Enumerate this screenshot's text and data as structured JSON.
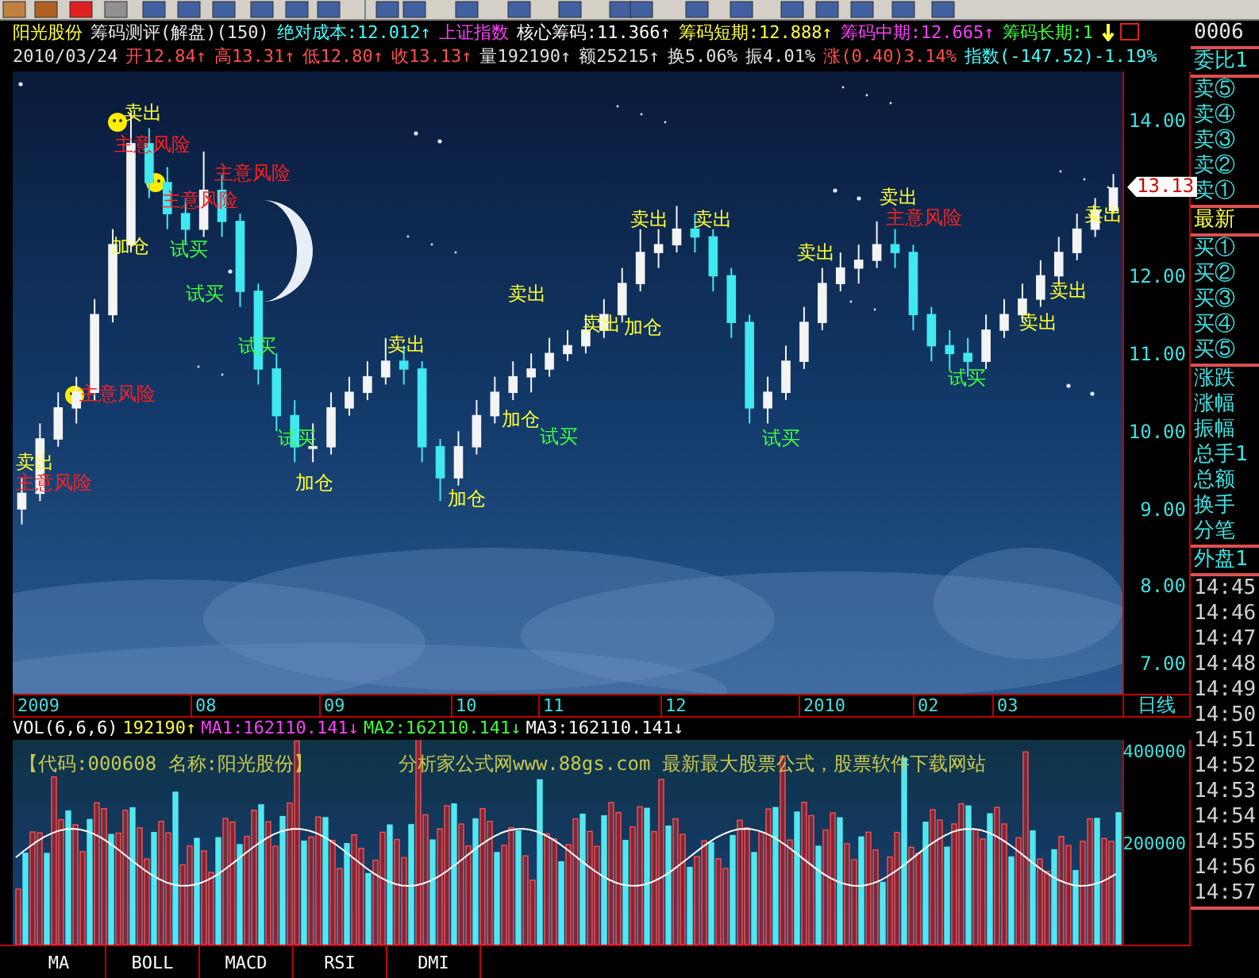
{
  "header": {
    "line1": [
      {
        "text": "阳光股份",
        "color": "#ffff40"
      },
      {
        "text": "筹码测评(解盘)(150)",
        "color": "#e8e8e8"
      },
      {
        "text": "绝对成本:12.012↑",
        "color": "#40ffff"
      },
      {
        "text": "上证指数",
        "color": "#ff40ff"
      },
      {
        "text": "核心筹码:11.366↑",
        "color": "#ffffff"
      },
      {
        "text": "筹码短期:12.888↑",
        "color": "#ffff40"
      },
      {
        "text": "筹码中期:12.665↑",
        "color": "#ff40ff"
      },
      {
        "text": "筹码长期:1",
        "color": "#40ff40"
      }
    ],
    "line2": [
      {
        "text": "2010/03/24",
        "color": "#e0e0e0"
      },
      {
        "text": "开12.84↑",
        "color": "#ff5050"
      },
      {
        "text": "高13.31↑",
        "color": "#ff5050"
      },
      {
        "text": "低12.80↑",
        "color": "#ff5050"
      },
      {
        "text": "收13.13↑",
        "color": "#ff5050"
      },
      {
        "text": "量192190↑",
        "color": "#e0e0e0"
      },
      {
        "text": "额25215↑",
        "color": "#e0e0e0"
      },
      {
        "text": "换5.06%",
        "color": "#e0e0e0"
      },
      {
        "text": "振4.01%",
        "color": "#e0e0e0"
      },
      {
        "text": "涨(0.40)3.14%",
        "color": "#ff5050"
      },
      {
        "text": "指数(-147.52)-1.19%",
        "color": "#40ffff"
      }
    ]
  },
  "chart": {
    "chart_data": {
      "type": "candlestick",
      "ylim": [
        6.62,
        14.63
      ],
      "categories": [
        null,
        null,
        null,
        null,
        null,
        null,
        null,
        null,
        null,
        null,
        null,
        null,
        null,
        null,
        null,
        null,
        null,
        null,
        null,
        null,
        null,
        null,
        null,
        null,
        null,
        null,
        null,
        null,
        null,
        null,
        null,
        null,
        null,
        null,
        null,
        null,
        null,
        null,
        null,
        null,
        null,
        null,
        null,
        null,
        null,
        null,
        null,
        null,
        null,
        null,
        null,
        null,
        null,
        null,
        null,
        null,
        null,
        null,
        null,
        null,
        null
      ],
      "yticks": [
        {
          "value": 14,
          "label": "14.00"
        },
        {
          "value": 12,
          "label": "12.00"
        },
        {
          "value": 11,
          "label": "11.00"
        },
        {
          "value": 10,
          "label": "10.00"
        },
        {
          "value": 9,
          "label": "9.00"
        },
        {
          "value": 8,
          "label": "8.00"
        },
        {
          "value": 7,
          "label": "7.00"
        }
      ],
      "ohlc": [
        [
          9.0,
          9.4,
          8.8,
          9.2
        ],
        [
          9.2,
          10.1,
          9.1,
          9.9
        ],
        [
          9.9,
          10.5,
          9.8,
          10.3
        ],
        [
          10.3,
          10.7,
          10.1,
          10.5
        ],
        [
          10.5,
          11.7,
          10.4,
          11.5
        ],
        [
          11.5,
          12.6,
          11.4,
          12.4
        ],
        [
          12.4,
          14.1,
          12.3,
          13.7
        ],
        [
          13.7,
          13.9,
          13.0,
          13.2
        ],
        [
          13.2,
          13.4,
          12.6,
          12.8
        ],
        [
          12.8,
          13.0,
          12.4,
          12.6
        ],
        [
          12.6,
          13.6,
          12.5,
          13.1
        ],
        [
          13.1,
          13.3,
          12.5,
          12.7
        ],
        [
          12.7,
          12.8,
          11.6,
          11.8
        ],
        [
          11.8,
          11.9,
          10.6,
          10.8
        ],
        [
          10.8,
          11.0,
          10.0,
          10.2
        ],
        [
          10.2,
          10.4,
          9.6,
          9.8
        ],
        [
          9.8,
          10.1,
          9.6,
          9.8
        ],
        [
          9.8,
          10.5,
          9.7,
          10.3
        ],
        [
          10.3,
          10.7,
          10.2,
          10.5
        ],
        [
          10.5,
          10.9,
          10.4,
          10.7
        ],
        [
          10.7,
          11.2,
          10.6,
          10.9
        ],
        [
          10.9,
          11.1,
          10.6,
          10.8
        ],
        [
          10.8,
          10.9,
          9.6,
          9.8
        ],
        [
          9.8,
          9.9,
          9.1,
          9.4
        ],
        [
          9.4,
          10.0,
          9.3,
          9.8
        ],
        [
          9.8,
          10.4,
          9.7,
          10.2
        ],
        [
          10.2,
          10.7,
          10.1,
          10.5
        ],
        [
          10.5,
          10.9,
          10.4,
          10.7
        ],
        [
          10.7,
          11.0,
          10.5,
          10.8
        ],
        [
          10.8,
          11.2,
          10.7,
          11.0
        ],
        [
          11.0,
          11.3,
          10.9,
          11.1
        ],
        [
          11.1,
          11.5,
          11.0,
          11.3
        ],
        [
          11.3,
          11.7,
          11.2,
          11.5
        ],
        [
          11.5,
          12.1,
          11.4,
          11.9
        ],
        [
          11.9,
          12.6,
          11.8,
          12.3
        ],
        [
          12.3,
          12.6,
          12.1,
          12.4
        ],
        [
          12.4,
          12.9,
          12.3,
          12.6
        ],
        [
          12.6,
          12.8,
          12.3,
          12.5
        ],
        [
          12.5,
          12.6,
          11.8,
          12.0
        ],
        [
          12.0,
          12.1,
          11.2,
          11.4
        ],
        [
          11.4,
          11.5,
          10.1,
          10.3
        ],
        [
          10.3,
          10.7,
          10.1,
          10.5
        ],
        [
          10.5,
          11.1,
          10.4,
          10.9
        ],
        [
          10.9,
          11.6,
          10.8,
          11.4
        ],
        [
          11.4,
          12.1,
          11.3,
          11.9
        ],
        [
          11.9,
          12.3,
          11.8,
          12.1
        ],
        [
          12.1,
          12.4,
          11.9,
          12.2
        ],
        [
          12.2,
          12.7,
          12.1,
          12.4
        ],
        [
          12.4,
          12.6,
          12.1,
          12.3
        ],
        [
          12.3,
          12.4,
          11.3,
          11.5
        ],
        [
          11.5,
          11.6,
          10.9,
          11.1
        ],
        [
          11.1,
          11.3,
          10.8,
          11.0
        ],
        [
          11.0,
          11.2,
          10.7,
          10.9
        ],
        [
          10.9,
          11.5,
          10.8,
          11.3
        ],
        [
          11.3,
          11.7,
          11.2,
          11.5
        ],
        [
          11.5,
          11.9,
          11.4,
          11.7
        ],
        [
          11.7,
          12.2,
          11.6,
          12.0
        ],
        [
          12.0,
          12.5,
          11.9,
          12.3
        ],
        [
          12.3,
          12.8,
          12.2,
          12.6
        ],
        [
          12.6,
          13.0,
          12.5,
          12.84
        ],
        [
          12.84,
          13.31,
          12.8,
          13.13
        ]
      ]
    },
    "signals": [
      {
        "text": "卖出",
        "kind": "sell"
      },
      {
        "text": "主意风险",
        "kind": "risk"
      },
      {
        "text": "主意风险",
        "kind": "risk"
      },
      {
        "text": "主意风险",
        "kind": "risk"
      },
      {
        "text": "卖出",
        "kind": "sell"
      },
      {
        "text": "卖出",
        "kind": "sell"
      },
      {
        "text": "卖出",
        "kind": "sell"
      },
      {
        "text": "主意风险",
        "kind": "risk"
      },
      {
        "text": "卖出",
        "kind": "sell"
      },
      {
        "text": "加仓",
        "kind": "add"
      },
      {
        "text": "试买",
        "kind": "buy"
      },
      {
        "text": "卖出",
        "kind": "sell"
      },
      {
        "text": "试买",
        "kind": "buy"
      },
      {
        "text": "卖出",
        "kind": "sell"
      },
      {
        "text": "卖出",
        "kind": "sell"
      },
      {
        "text": "卖出",
        "kind": "sell"
      },
      {
        "text": "加仓",
        "kind": "add"
      },
      {
        "text": "卖出",
        "kind": "sell"
      },
      {
        "text": "试买",
        "kind": "buy"
      },
      {
        "text": "卖出",
        "kind": "sell"
      },
      {
        "text": "试买",
        "kind": "buy"
      },
      {
        "text": "主意风险",
        "kind": "risk"
      },
      {
        "text": "加仓",
        "kind": "add"
      },
      {
        "text": "试买",
        "kind": "buy"
      },
      {
        "text": "试买",
        "kind": "buy"
      },
      {
        "text": "试买",
        "kind": "buy"
      },
      {
        "text": "卖出",
        "kind": "sell"
      },
      {
        "text": "主意风险",
        "kind": "risk"
      },
      {
        "text": "加仓",
        "kind": "add"
      },
      {
        "text": "加仓",
        "kind": "add"
      }
    ],
    "last_price": "13.13",
    "dates": [
      "2009",
      "08",
      "09",
      "10",
      "11",
      "12",
      "2010",
      "02",
      "03"
    ],
    "period": "日线"
  },
  "volume": {
    "legend": [
      {
        "text": "VOL(6,6,6)",
        "color": "#ffffff"
      },
      {
        "text": "192190↑",
        "color": "#ffff40"
      },
      {
        "text": "MA1:162110.141↓",
        "color": "#ff40ff"
      },
      {
        "text": "MA2:162110.141↓",
        "color": "#40ff40"
      },
      {
        "text": "MA3:162110.141↓",
        "color": "#ffffff"
      }
    ],
    "stock_note": "【代码:000608 名称:阳光股份】",
    "site_note": "分析家公式网www.88gs.com 最新最大股票公式，股票软件下载网站",
    "ticks": [
      "400000",
      "200000"
    ]
  },
  "indicator_tabs": [
    "MA",
    "BOLL",
    "MACD",
    "RSI",
    "DMI"
  ],
  "quote_panel": [
    {
      "kind": "code",
      "items": [
        "0006"
      ]
    },
    {
      "kind": "label",
      "items": [
        "委比1"
      ]
    },
    {
      "kind": "label",
      "items": [
        "卖⑤",
        "卖④",
        "卖③",
        "卖②",
        "卖①"
      ]
    },
    {
      "kind": "latest",
      "items": [
        "最新"
      ]
    },
    {
      "kind": "label",
      "items": [
        "买①",
        "买②",
        "买③",
        "买④",
        "买⑤"
      ]
    },
    {
      "kind": "label",
      "items": [
        "涨跌",
        "涨幅",
        "振幅",
        "总手1",
        "总额",
        "换手",
        "分笔"
      ]
    },
    {
      "kind": "label",
      "items": [
        "外盘1"
      ]
    },
    {
      "kind": "time",
      "items": [
        "14:45",
        "14:46",
        "14:47",
        "14:48",
        "14:49",
        "14:50",
        "14:51",
        "14:52",
        "14:53",
        "14:54",
        "14:55",
        "14:56",
        "14:57"
      ]
    }
  ]
}
